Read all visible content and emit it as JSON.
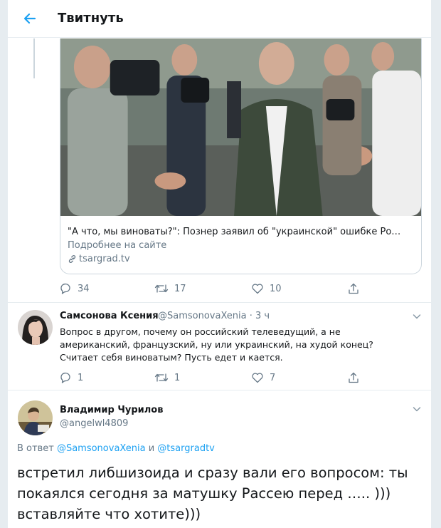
{
  "header": {
    "title": "Твитнуть"
  },
  "card": {
    "headline": "\"А что, мы виноваты?\": Познер заявил об \"украинской\" ошибке Ро…",
    "more_label": "Подробнее на сайте",
    "domain": "tsargrad.tv"
  },
  "tweet_actions": {
    "replies": "34",
    "retweets": "17",
    "likes": "10"
  },
  "reply": {
    "name": "Самсонова Ксения",
    "handle": "@SamsonovaXenia · 3 ч",
    "text": "Вопрос в другом, почему он российский телеведущий, а не американский, французский, ну или украинский, на худой конец? Считает себя виноватым? Пусть едет и кается.",
    "actions": {
      "replies": "1",
      "retweets": "1",
      "likes": "7"
    }
  },
  "main": {
    "name": "Владимир Чурилов",
    "handle": "@angelwl4809",
    "in_reply_prefix": "В ответ",
    "in_reply_user1": "@SamsonovaXenia",
    "in_reply_and": "и",
    "in_reply_user2": "@tsargradtv",
    "text": "встретил либшизоида и сразу вали его вопросом: ты покаялся сегодня за матушку Рассею перед ….. ))) вставляйте что хотите)))"
  },
  "colors": {
    "accent": "#1da1f2",
    "muted": "#657786",
    "border": "#e6ecf0"
  }
}
